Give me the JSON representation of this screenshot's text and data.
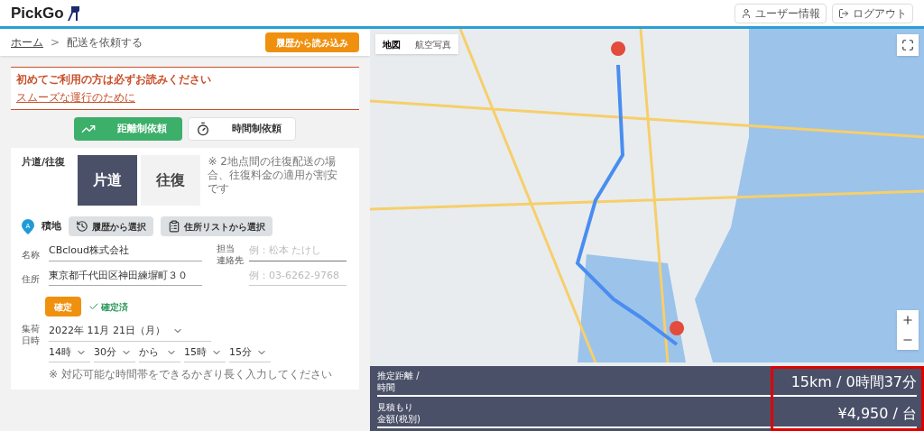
{
  "header": {
    "logo": "PickGo",
    "buttons": [
      {
        "kind": "user",
        "label": "ユーザー情報"
      },
      {
        "kind": "logout",
        "label": "ログアウト"
      }
    ]
  },
  "breadcrumb": {
    "home": "ホーム",
    "separator": ">",
    "current": "配送を依頼する"
  },
  "history_button": "履歴から読み込み",
  "notice": {
    "title": "初めてご利用の方は必ずお読みください",
    "link": "スムーズな運行のために"
  },
  "request_types": [
    {
      "kind": "distance",
      "label": "距離制依頼",
      "selected": true
    },
    {
      "kind": "time",
      "label": "時間制依頼",
      "selected": false
    }
  ],
  "trip": {
    "label": "片道/往復",
    "options": [
      {
        "label": "片道",
        "selected": true
      },
      {
        "label": "往復",
        "selected": false
      }
    ],
    "note": "※ 2地点間の往復配送の場合、往復料金の適用が割安です"
  },
  "pickup": {
    "marker": "A",
    "title": "積地",
    "buttons": [
      {
        "kind": "history",
        "label": "履歴から選択"
      },
      {
        "kind": "list",
        "label": "住所リストから選択"
      }
    ],
    "name_label": "名称",
    "name_value": "CBcloud株式会社",
    "address_label": "住所",
    "address_value": "東京都千代田区神田練塀町３０",
    "contact_label": [
      "担当",
      "連絡先"
    ],
    "contact_name_placeholder": "例：松本 たけし",
    "contact_phone_placeholder": "例：03-6262-9768",
    "confirm_button": "確定",
    "confirmed": true,
    "confirmed_label": "確定済",
    "datetime_label": [
      "集荷",
      "日時"
    ],
    "date": "2022年 11月 21日（月）",
    "times": [
      "14時",
      "30分",
      "から",
      "15時",
      "15分"
    ],
    "time_note": "※ 対応可能な時間帯をできるかぎり長く入力してください"
  },
  "map": {
    "tabs": [
      {
        "label": "地図",
        "selected": true
      },
      {
        "label": "航空写真",
        "selected": false
      }
    ]
  },
  "estimate": [
    {
      "label": [
        "推定距離 /",
        "時間"
      ],
      "value": "15km / 0時間37分"
    },
    {
      "label": [
        "見積もり",
        "金額(税別)"
      ],
      "value": "¥4,950 / 台"
    }
  ]
}
